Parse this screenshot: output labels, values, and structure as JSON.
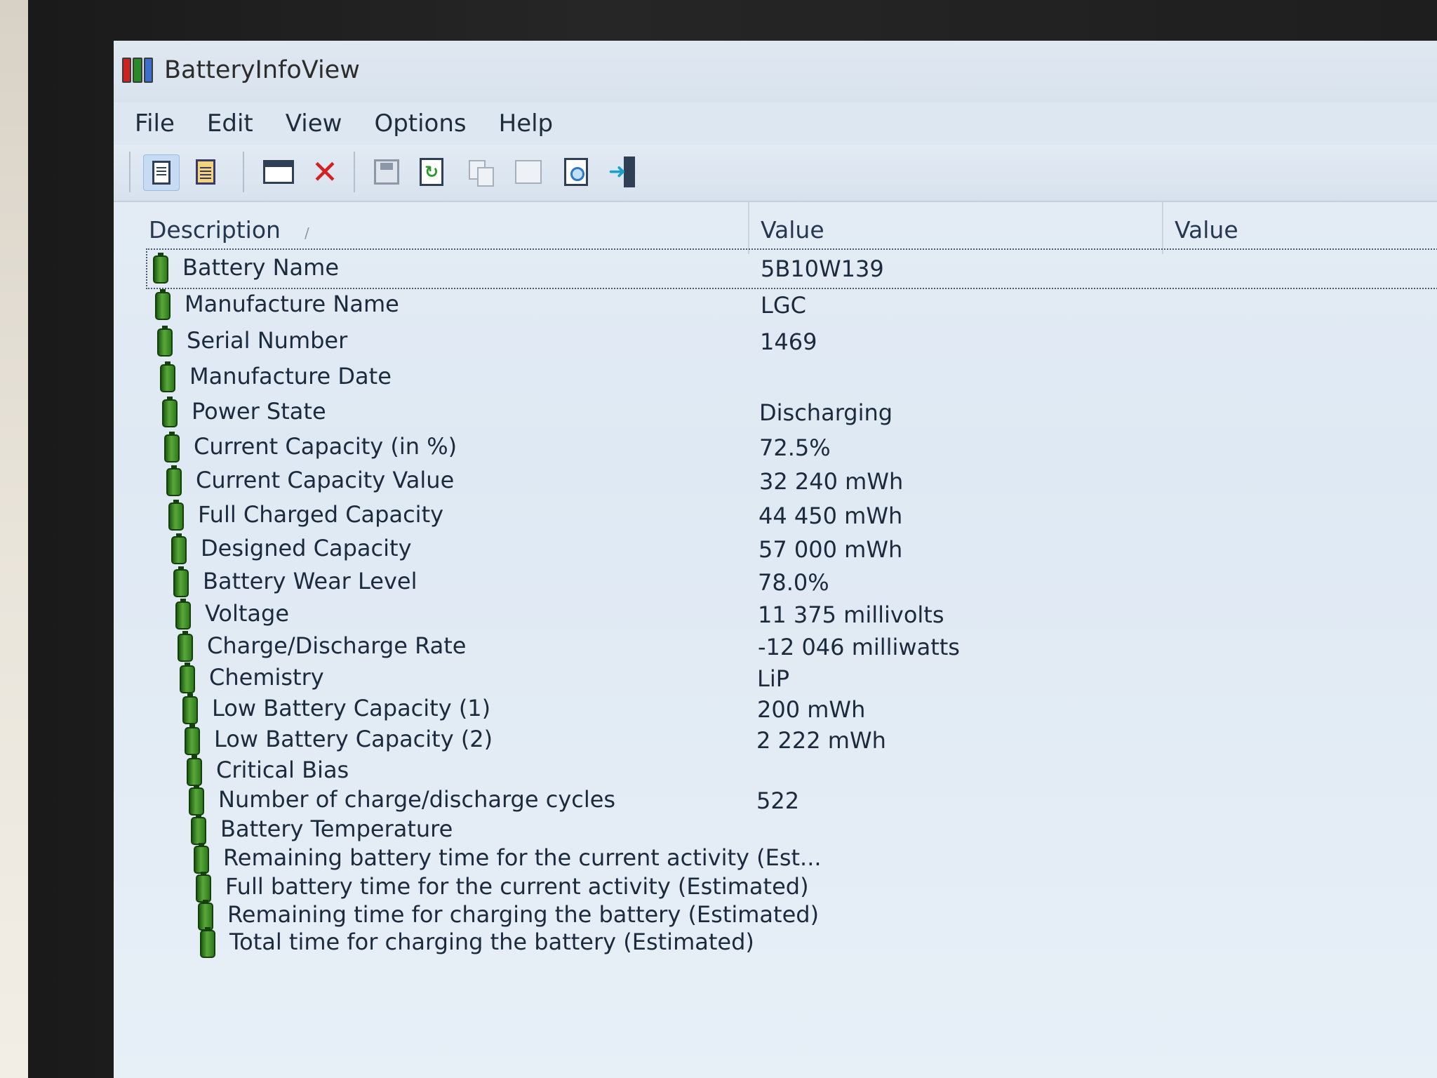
{
  "window": {
    "title": "BatteryInfoView"
  },
  "menu": [
    "File",
    "Edit",
    "View",
    "Options",
    "Help"
  ],
  "toolbar": [
    {
      "icon": "html-report-icon"
    },
    {
      "icon": "clipboard-icon"
    },
    {
      "icon": "window-icon"
    },
    {
      "icon": "delete-icon"
    },
    {
      "icon": "save-icon"
    },
    {
      "icon": "refresh-icon"
    },
    {
      "icon": "copy-icon"
    },
    {
      "icon": "properties-icon"
    },
    {
      "icon": "find-icon"
    },
    {
      "icon": "exit-icon"
    }
  ],
  "columns": {
    "description": "Description",
    "value": "Value",
    "value2": "Value"
  },
  "rows": [
    {
      "description": "Battery Name",
      "value": "5B10W139"
    },
    {
      "description": "Manufacture Name",
      "value": "LGC"
    },
    {
      "description": "Serial Number",
      "value": " 1469"
    },
    {
      "description": "Manufacture Date",
      "value": ""
    },
    {
      "description": "Power State",
      "value": "Discharging"
    },
    {
      "description": "Current Capacity (in %)",
      "value": "72.5%"
    },
    {
      "description": "Current Capacity Value",
      "value": "32 240 mWh"
    },
    {
      "description": "Full Charged Capacity",
      "value": "44 450 mWh"
    },
    {
      "description": "Designed Capacity",
      "value": "57 000 mWh"
    },
    {
      "description": "Battery Wear Level",
      "value": "78.0%"
    },
    {
      "description": "Voltage",
      "value": "11 375 millivolts"
    },
    {
      "description": "Charge/Discharge Rate",
      "value": "-12 046 milliwatts"
    },
    {
      "description": "Chemistry",
      "value": "LiP"
    },
    {
      "description": "Low Battery Capacity (1)",
      "value": "200 mWh"
    },
    {
      "description": "Low Battery Capacity (2)",
      "value": "2 222 mWh"
    },
    {
      "description": "Critical Bias",
      "value": ""
    },
    {
      "description": "Number of charge/discharge cycles",
      "value": "522"
    },
    {
      "description": "Battery Temperature",
      "value": ""
    },
    {
      "description": "Remaining battery time for the current activity (Est...",
      "value": ""
    },
    {
      "description": "Full battery time for the current activity (Estimated)",
      "value": ""
    },
    {
      "description": "Remaining time for charging the battery (Estimated)",
      "value": ""
    },
    {
      "description": "Total  time for charging the battery (Estimated)",
      "value": ""
    }
  ]
}
